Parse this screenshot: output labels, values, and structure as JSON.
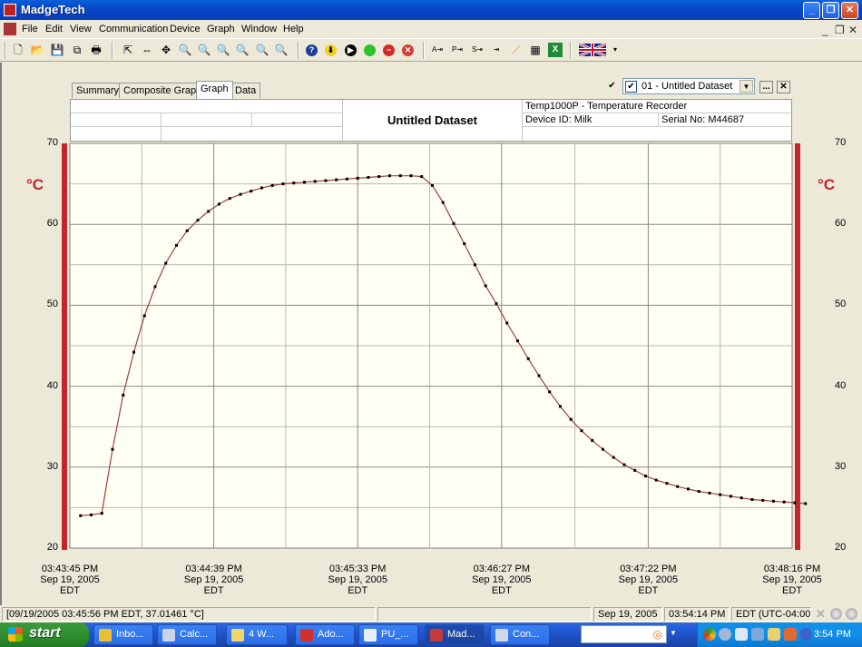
{
  "window": {
    "title": "MadgeTech",
    "controls": {
      "minimize": "_",
      "restore": "❐",
      "close": "✕"
    }
  },
  "menubar": {
    "items": [
      "File",
      "Edit",
      "View",
      "Communication",
      "Device",
      "Graph",
      "Window",
      "Help"
    ],
    "mdi_controls": {
      "minimize": "_",
      "restore": "❐",
      "close": "✕"
    }
  },
  "toolbar": {
    "groups": [
      [
        "new-file-icon",
        "open-folder-icon",
        "save-icon",
        "copy-pages-icon",
        "print-icon"
      ],
      [
        "select-pointer-icon",
        "pan-horizontal-icon",
        "move-icon",
        "zoom-in-icon",
        "zoom-out-icon",
        "zoom-region-icon",
        "zoom-horizontal-icon",
        "zoom-vertical-icon",
        "zoom-reset-icon"
      ],
      [
        "help-icon",
        "download-icon",
        "start-icon",
        "go-icon",
        "stop-icon",
        "cancel-icon"
      ],
      [
        "annotation-a-icon",
        "annotation-p-icon",
        "annotation-s-icon",
        "annotation-icon",
        "trace-icon",
        "calculator-icon",
        "excel-export-icon"
      ],
      [
        "uk-flag-icon"
      ]
    ]
  },
  "tabs": [
    {
      "label": "Summary",
      "active": false
    },
    {
      "label": "Composite Graph",
      "active": false
    },
    {
      "label": "Graph",
      "active": true
    },
    {
      "label": "Data",
      "active": false
    }
  ],
  "dataset_selector": {
    "show_all_checked": true,
    "item_checked": true,
    "selected": "01 - Untitled Dataset",
    "more_label": "...",
    "close_label": "✕"
  },
  "header": {
    "title": "Untitled Dataset",
    "device_model": "Temp1000P - Temperature Recorder",
    "device_id": "Device ID: Milk",
    "serial_no": "Serial No: M44687"
  },
  "chart_data": {
    "type": "line",
    "title": "Untitled Dataset",
    "xlabel": "",
    "ylabel": "°C",
    "ylim": [
      20,
      70
    ],
    "yticks": [
      20,
      30,
      40,
      50,
      60,
      70
    ],
    "grid": true,
    "markers": true,
    "line_color": "#a0403a",
    "marker_color": "#000000",
    "axis_bar_color": "#c0262b",
    "plot_bg": "#fffff4",
    "xlim_seconds": [
      0,
      271
    ],
    "xtick_seconds": [
      0,
      54,
      108,
      162,
      217,
      271
    ],
    "xtick_labels": [
      [
        "03:43:45 PM",
        "Sep 19, 2005",
        "EDT"
      ],
      [
        "03:44:39 PM",
        "Sep 19, 2005",
        "EDT"
      ],
      [
        "03:45:33 PM",
        "Sep 19, 2005",
        "EDT"
      ],
      [
        "03:46:27 PM",
        "Sep 19, 2005",
        "EDT"
      ],
      [
        "03:47:22 PM",
        "Sep 19, 2005",
        "EDT"
      ],
      [
        "03:48:16 PM",
        "Sep 19, 2005",
        "EDT"
      ]
    ],
    "series": [
      {
        "name": "01 - Untitled Dataset",
        "sample_interval_s": 4,
        "start_s": 4,
        "values": [
          24.0,
          24.1,
          24.3,
          32.2,
          38.9,
          44.2,
          48.7,
          52.3,
          55.2,
          57.4,
          59.2,
          60.5,
          61.6,
          62.5,
          63.2,
          63.7,
          64.1,
          64.5,
          64.8,
          65.0,
          65.1,
          65.2,
          65.3,
          65.4,
          65.5,
          65.6,
          65.7,
          65.8,
          65.9,
          66.0,
          66.0,
          66.0,
          65.9,
          64.8,
          62.7,
          60.1,
          57.6,
          55.0,
          52.4,
          50.2,
          47.8,
          45.6,
          43.4,
          41.3,
          39.3,
          37.5,
          35.9,
          34.5,
          33.3,
          32.2,
          31.2,
          30.3,
          29.6,
          28.9,
          28.4,
          28.0,
          27.6,
          27.3,
          27.0,
          26.8,
          26.6,
          26.4,
          26.2,
          26.0,
          25.9,
          25.8,
          25.7,
          25.6,
          25.5
        ]
      }
    ]
  },
  "statusbar": {
    "cursor_readout": "[09/19/2005 03:45:56 PM EDT, 37.01461 °C]",
    "date": "Sep 19, 2005",
    "time": "03:54:14 PM",
    "timezone": "EDT (UTC-04:00)"
  },
  "taskbar": {
    "start_label": "start",
    "tasks": [
      {
        "label": "Inbo...",
        "icon": "outlook-icon",
        "color": "#e8c030",
        "active": false
      },
      {
        "label": "Calc...",
        "icon": "calculator-icon",
        "color": "#c9d4e8",
        "active": false
      },
      {
        "label": "4 W...",
        "icon": "folder-icon",
        "color": "#f2d46a",
        "active": false
      },
      {
        "label": "Ado...",
        "icon": "adobe-icon",
        "color": "#d4302a",
        "active": false
      },
      {
        "label": "PU_...",
        "icon": "word-icon",
        "color": "#e8eef8",
        "active": false
      },
      {
        "label": "Mad...",
        "icon": "madgetech-icon",
        "color": "#c43a3a",
        "active": true
      },
      {
        "label": "Con...",
        "icon": "connection-icon",
        "color": "#d0d8e8",
        "active": false
      }
    ],
    "clock": "3:54 PM"
  }
}
